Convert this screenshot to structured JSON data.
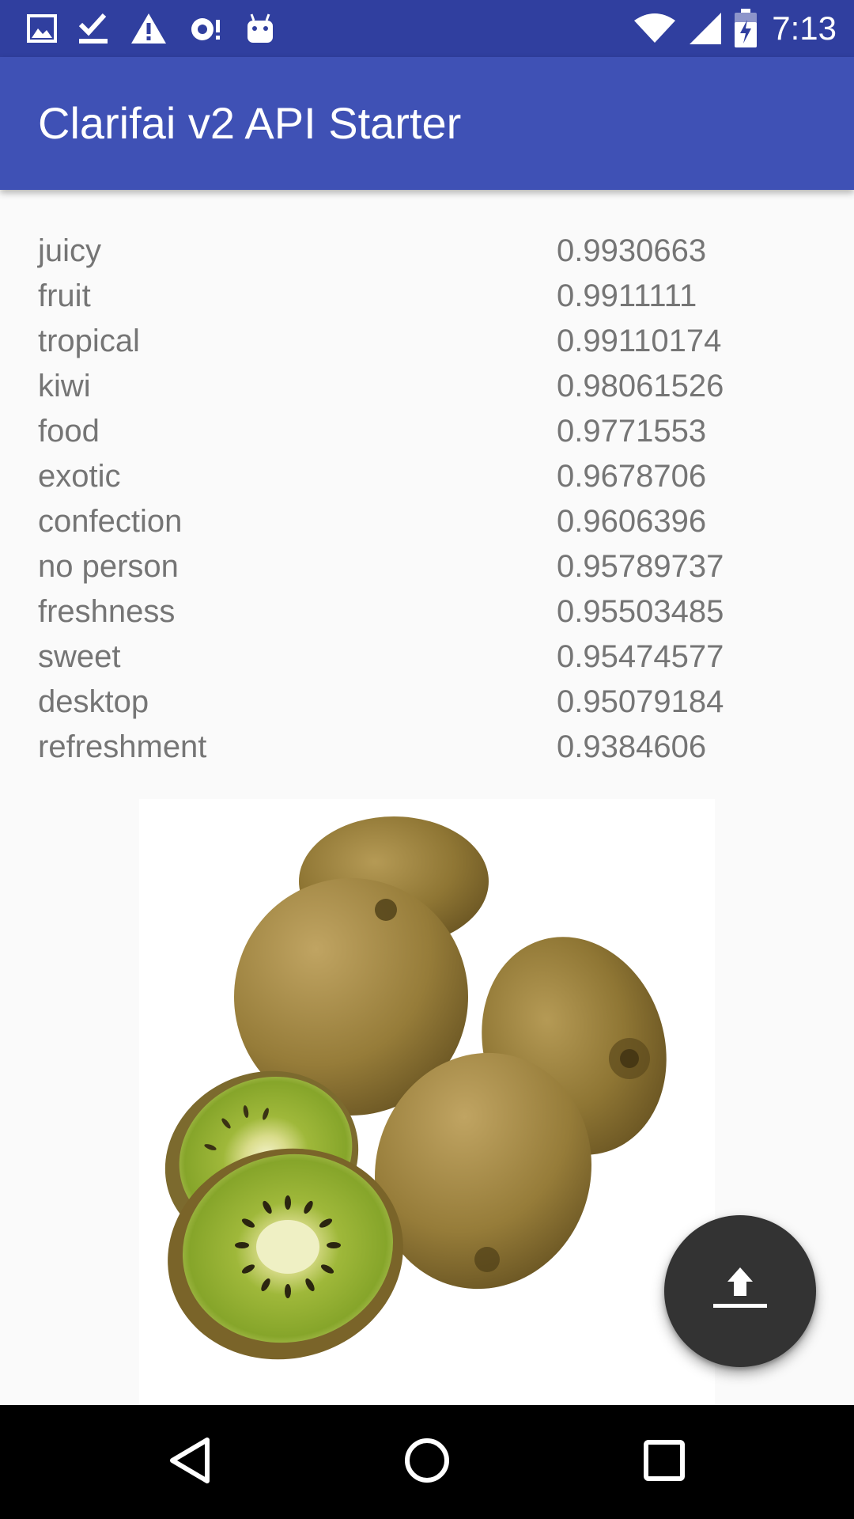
{
  "status_bar": {
    "time": "7:13",
    "left_icons": [
      "image-icon",
      "download-done-icon",
      "warning-icon",
      "sync-icon",
      "android-icon"
    ],
    "right_icons": [
      "wifi-icon",
      "cell-signal-icon",
      "battery-charging-icon"
    ]
  },
  "app_bar": {
    "title": "Clarifai v2 API Starter",
    "color": "#3f51b5"
  },
  "results": [
    {
      "name": "juicy",
      "value": "0.9930663"
    },
    {
      "name": "fruit",
      "value": "0.9911111"
    },
    {
      "name": "tropical",
      "value": "0.99110174"
    },
    {
      "name": "kiwi",
      "value": "0.98061526"
    },
    {
      "name": "food",
      "value": "0.9771553"
    },
    {
      "name": "exotic",
      "value": "0.9678706"
    },
    {
      "name": "confection",
      "value": "0.9606396"
    },
    {
      "name": "no person",
      "value": "0.95789737"
    },
    {
      "name": "freshness",
      "value": "0.95503485"
    },
    {
      "name": "sweet",
      "value": "0.95474577"
    },
    {
      "name": "desktop",
      "value": "0.95079184"
    },
    {
      "name": "refreshment",
      "value": "0.9384606"
    }
  ],
  "image": {
    "subject": "kiwi-fruit-image"
  },
  "fab": {
    "icon": "upload-icon",
    "color": "#333333"
  },
  "nav_bar": {
    "buttons": [
      "back-icon",
      "home-icon",
      "recents-icon"
    ]
  }
}
